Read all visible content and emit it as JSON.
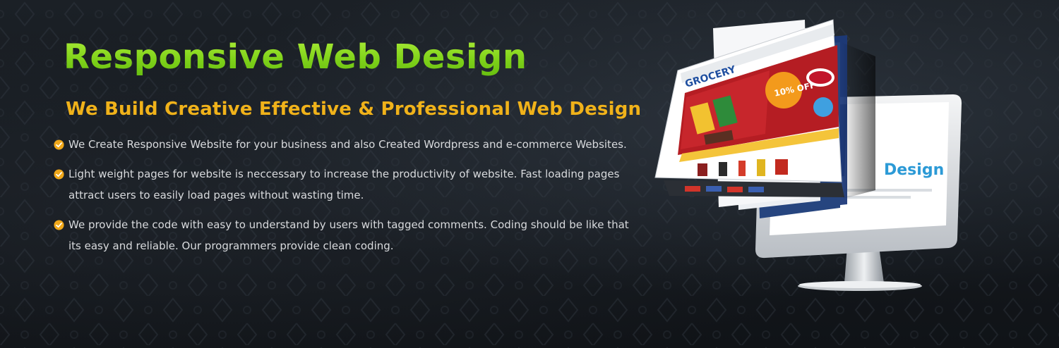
{
  "banner": {
    "headline": "Responsive Web Design",
    "subheadline": "We Build Creative Effective & Professional Web Design",
    "features": [
      {
        "icon": "check-circle-icon",
        "text": "We Create Responsive Website for your business and also Created Wordpress and e-commerce Websites."
      },
      {
        "icon": "check-circle-icon",
        "text": "Light weight pages for website is neccessary to increase the productivity of website. Fast loading pages attract users to easily load pages without wasting time."
      },
      {
        "icon": "check-circle-icon",
        "text": "We provide the code with easy to understand by users with tagged comments. Coding should be like that its easy and reliable. Our programmers provide clean coding."
      }
    ],
    "illustration": {
      "description_icon": "monitor-with-website-screens-icon",
      "screen_logo": "GROCERY",
      "promo_badge": "10% OFF",
      "screen_word": "Design",
      "screen_fragment": "es"
    },
    "colors": {
      "headline_top": "#b6f23e",
      "headline_bottom": "#5fb80d",
      "subheadline": "#f0b21a",
      "body_text": "#d8dadd",
      "check_icon": "#f0a81a",
      "background": "#14181d"
    }
  }
}
